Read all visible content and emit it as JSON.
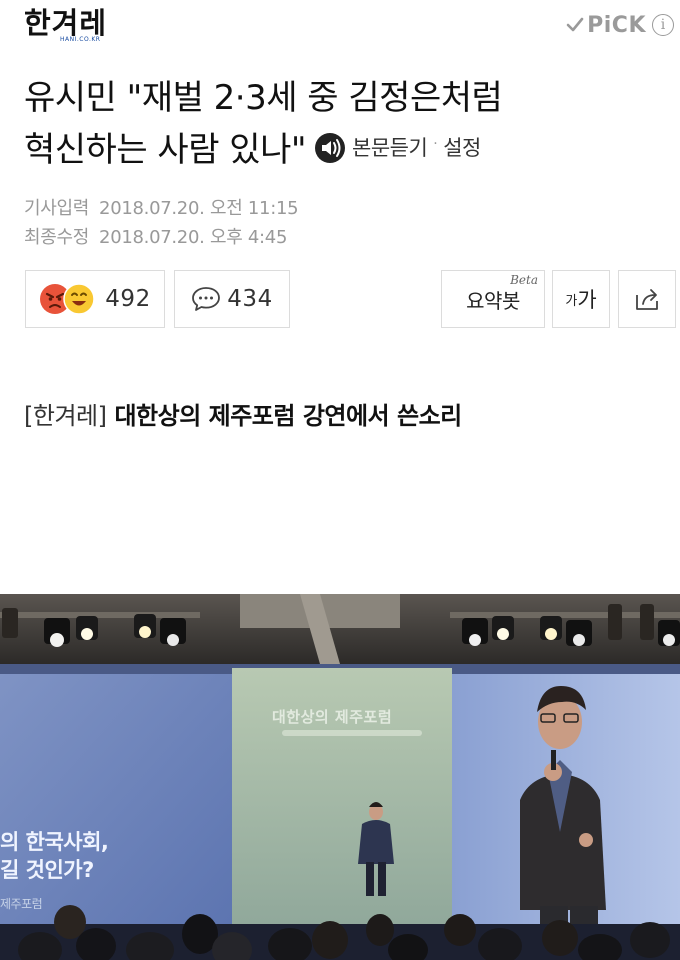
{
  "header": {
    "logo_main": "한겨레",
    "logo_sub": "HANI.CO.KR",
    "pick_label": "PiCK",
    "pick_info": "i"
  },
  "article": {
    "title_line1": "유시민 \"재벌 2·3세 중 김정은처럼",
    "title_line2": "혁신하는 사람 있나\"",
    "listen_label": "본문듣기",
    "listen_separator": "·",
    "settings_label": "설정",
    "meta": {
      "published_label": "기사입력",
      "published_value": "2018.07.20. 오전 11:15",
      "modified_label": "최종수정",
      "modified_value": "2018.07.20. 오후 4:45"
    },
    "reactions_count": "492",
    "comments_count": "434",
    "summary_label": "요약봇",
    "summary_badge": "Beta",
    "font_small": "가",
    "font_big": "가",
    "lede_source": "[한겨레]",
    "lede_text": "대한상의 제주포럼 강연에서 쓴소리"
  },
  "photo": {
    "screen_left_line1": "의 한국사회,",
    "screen_left_line2": "길 것인가?",
    "screen_left_sub": "제주포럼",
    "screen_center_title": "대한상의 제주포럼"
  },
  "colors": {
    "text_primary": "#111111",
    "text_meta": "#999999",
    "border": "#dcdcdc",
    "angry_face": "#e8533a",
    "laugh_face": "#f9c832",
    "logo_sub": "#1a4da2"
  },
  "icons": {
    "pick_check": "check-icon",
    "listen": "speaker-audio-icon",
    "comment": "speech-bubble-icon",
    "share": "share-icon",
    "reaction_angry": "angry-face-icon",
    "reaction_laugh": "laugh-face-icon"
  }
}
